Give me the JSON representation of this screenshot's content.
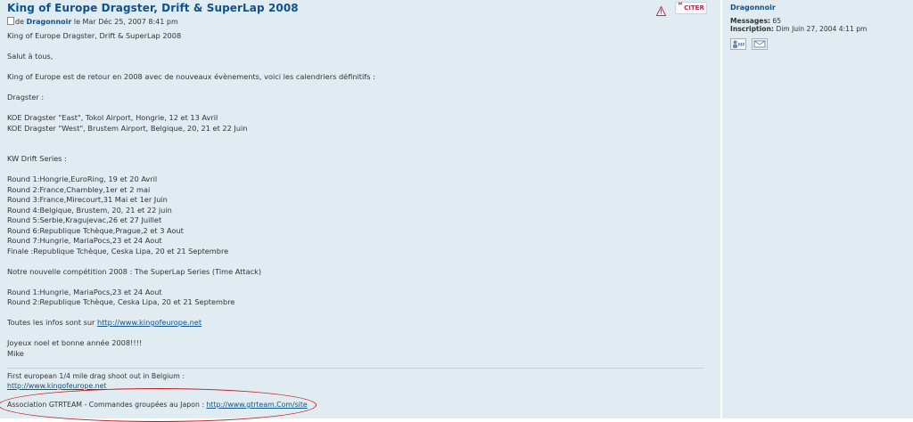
{
  "post": {
    "title": "King of Europe Dragster, Drift & SuperLap 2008",
    "byline_prefix": "de ",
    "author": "Dragonnoir",
    "byline_date": " le Mar Déc 25, 2007 8:41 pm",
    "quote_label": "CITER",
    "lines": [
      "King of Europe Dragster, Drift & SuperLap 2008",
      "",
      "Salut à tous,",
      "",
      "King of Europe est de retour en 2008 avec de nouveaux évènements, voici les calendriers définitifs :",
      "",
      "Dragster :",
      "",
      "KOE Dragster \"East\", Tokol Airport, Hongrie, 12 et 13 Avril",
      "KOE Dragster \"West\", Brustem Airport, Belgique, 20, 21 et 22 Juin",
      "",
      "",
      "KW Drift Series :",
      "",
      "Round 1:Hongrie,EuroRing, 19 et 20 Avril",
      "Round 2:France,Chambley,1er et 2 mai",
      "Round 3:France,Mirecourt,31 Mai et 1er Juin",
      "Round 4:Belgique, Brustem, 20, 21 et 22 juin",
      "Round 5:Serbie,Kragujevac,26 et 27 Juillet",
      "Round 6:Republique Tchèque,Prague,2 et 3 Aout",
      "Round 7:Hungrie, MariaPocs,23 et 24 Aout",
      "Finale :Republique Tchèque, Ceska Lipa, 20 et 21 Septembre",
      "",
      "Notre nouvelle compétition 2008 : The SuperLap Series (Time Attack)",
      "",
      "Round 1:Hungrie, MariaPocs,23 et 24 Aout",
      "Round 2:Republique Tchèque, Ceska Lipa, 20 et 21 Septembre",
      ""
    ],
    "infos_prefix": "Toutes les infos sont sur ",
    "infos_link": "http://www.kingofeurope.net",
    "closing_lines": [
      "",
      "Joyeux noel et bonne année 2008!!!!",
      "Mike"
    ]
  },
  "signature": {
    "line1": "First european 1/4 mile drag shoot out in Belgium :",
    "link1": "http://www.kingofeurope.net",
    "assoc_prefix": "Association GTRTEAM - Commandes groupées au Japon : ",
    "assoc_link": "http://www.gtrteam.Com/site"
  },
  "profile": {
    "name": "Dragonnoir",
    "messages_label": "Messages:",
    "messages_value": " 65",
    "inscription_label": "Inscription:",
    "inscription_value": " Dim Juin 27, 2004 4:11 pm"
  },
  "colors": {
    "panel_bg": "#e1ebf2",
    "link": "#105289",
    "highlight_ellipse": "#c01818",
    "quote_text": "#bc2a4d"
  },
  "icons": [
    "post-icon",
    "warning-icon",
    "quote-icon",
    "pm-icon",
    "email-icon"
  ]
}
